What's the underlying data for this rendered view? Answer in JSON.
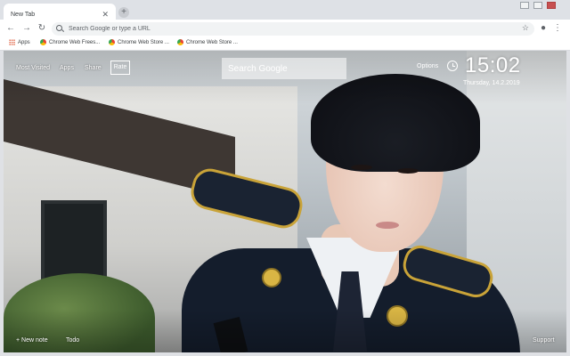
{
  "browser": {
    "tab": {
      "title": "New Tab",
      "close_glyph": "✕"
    },
    "new_tab_glyph": "+",
    "nav": {
      "back": "←",
      "forward": "→",
      "reload": "↻"
    },
    "omnibox": {
      "placeholder": "Search Google or type a URL",
      "star": "☆"
    },
    "profile_glyph": "●",
    "menu_glyph": "⋮",
    "bookmarks": [
      {
        "label": "Apps",
        "icon": "apps-grid-icon"
      },
      {
        "label": "Chrome Web Frees...",
        "icon": "chrome-web-store-icon"
      },
      {
        "label": "Chrome Web Store ...",
        "icon": "chrome-web-store-icon"
      },
      {
        "label": "Chrome Web Store ...",
        "icon": "chrome-web-store-icon"
      }
    ]
  },
  "newtab": {
    "top_links": [
      "Most Visited",
      "Apps",
      "Share"
    ],
    "rate_label": "Rate",
    "search": {
      "placeholder": "Search Google"
    },
    "options_label": "Options",
    "clock": {
      "time": "15:02",
      "date": "Thursday, 14.2.2019"
    },
    "bottom_links": {
      "new_note": "+ New note",
      "todo": "Todo",
      "support": "Support"
    }
  },
  "colors": {
    "tabstrip": "#dee1e6",
    "toolbar": "#ffffff",
    "overlay_text": "#ffffff",
    "uniform": "#141d2c",
    "epaulet_trim": "#c9a338"
  }
}
